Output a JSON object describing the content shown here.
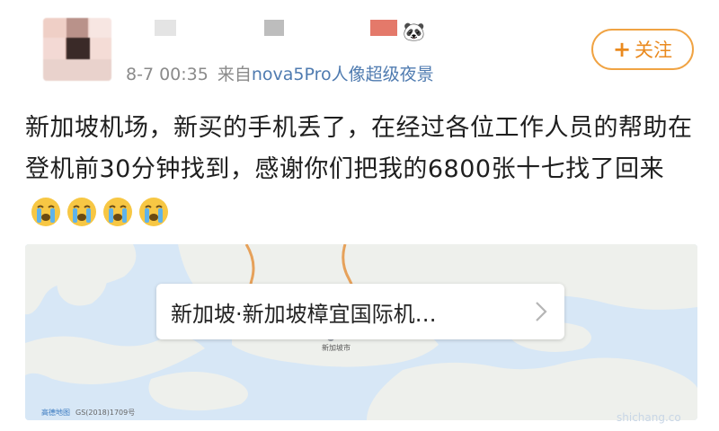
{
  "header": {
    "emoji": "🐼",
    "time": "8-7 00:35",
    "source_prefix": "来自",
    "source_device": "nova5Pro人像超级夜景",
    "follow_plus": "+",
    "follow_label": "关注"
  },
  "post": {
    "text": "新加坡机场，新买的手机丢了，在经过各位工作人员的帮助在登机前30分钟找到，感谢你们把我的6800张十七找了回来",
    "emojis": [
      "crying-face",
      "crying-face",
      "crying-face",
      "crying-face"
    ]
  },
  "map": {
    "place_label": "新加坡·新加坡樟宜国际机…",
    "city_label": "新加坡市",
    "provider": "高德地图",
    "license": "GS(2018)1709号",
    "watermark": "shichang.co"
  },
  "colors": {
    "accent_orange": "#ea8a1f",
    "link_blue": "#4f7bb0",
    "sea": "#d7e7f6",
    "land": "#eef0ec"
  }
}
